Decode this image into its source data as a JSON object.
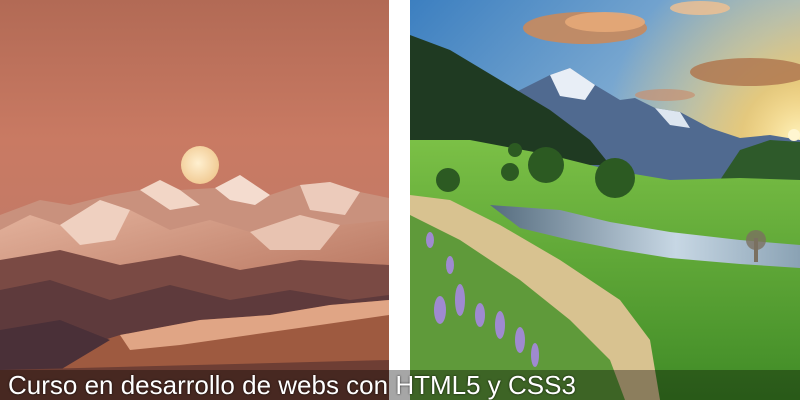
{
  "caption": {
    "text": "Curso en desarrollo de webs con HTML5 y CSS3"
  },
  "images": [
    {
      "name": "moon-over-mountains-photo"
    },
    {
      "name": "sunset-valley-river-photo"
    }
  ]
}
